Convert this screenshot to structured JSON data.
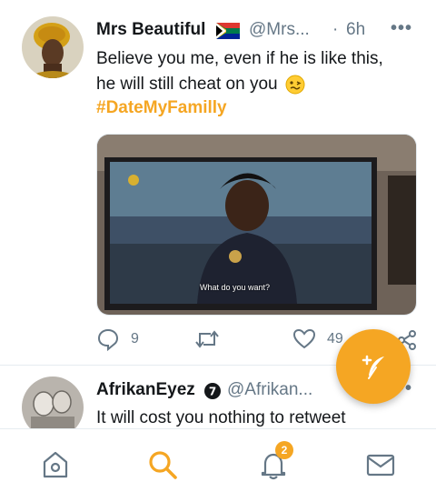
{
  "tweet1": {
    "name": "Mrs Beautiful",
    "flag_icon": "south-africa-flag-icon",
    "handle": "@Mrs...",
    "sep": "·",
    "time": "6h",
    "more": "•••",
    "text_line1": "Believe you me, even if he is like this,",
    "text_line2": "he will still cheat on you",
    "emoji_icon": "woozy-face-emoji-icon",
    "hashtag": "#DateMyFamilly",
    "media_subtitle": "What do you want?",
    "reply_count": "9",
    "like_count": "49"
  },
  "tweet2": {
    "name": "AfrikanEyez",
    "handle": "@Afrikan...",
    "more": "•••",
    "text_line1": "It will cost you nothing to retweet"
  },
  "navbar": {
    "notifications_badge": "2"
  },
  "colors": {
    "accent": "#f5a623",
    "text_secondary": "#657786",
    "divider": "#e6ecf0"
  }
}
